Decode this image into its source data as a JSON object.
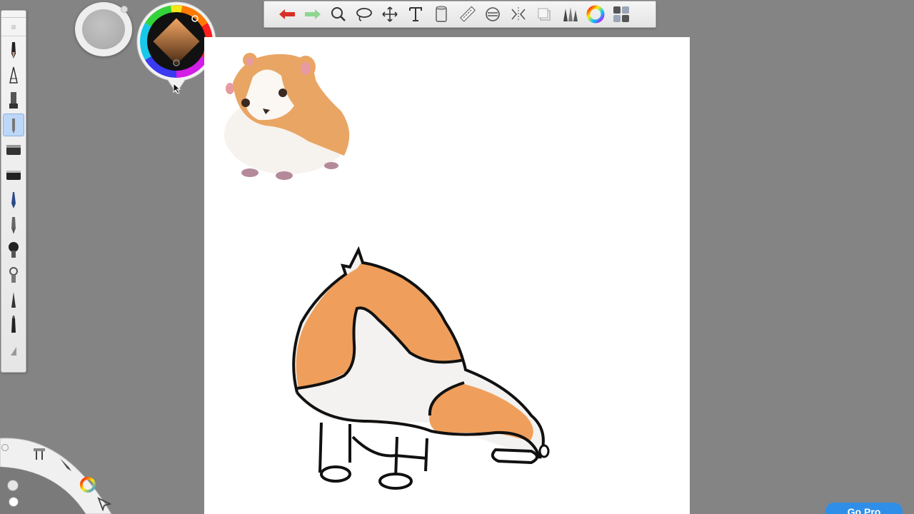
{
  "app": {
    "upgrade_button_label": "Go Pro"
  },
  "colors": {
    "background": "#848484",
    "undo_arrow": "#d93025",
    "redo_arrow": "#8fd68f",
    "hamster_orange": "#f0a661",
    "upgrade_blue": "#2f8fe8"
  },
  "toolbar": {
    "items": [
      "undo-icon",
      "redo-icon",
      "zoom-icon",
      "lasso-icon",
      "move-icon",
      "text-icon",
      "fill-icon",
      "ruler-icon",
      "symmetry-icon",
      "perspective-icon",
      "copy-icon",
      "brush-library-icon",
      "color-icon",
      "layers-icon"
    ]
  },
  "tool_palette": {
    "tools": [
      "pencil",
      "ballpoint-pen",
      "marker",
      "airbrush",
      "eraser",
      "hard-eraser",
      "paint-brush",
      "fine-pen",
      "soft-brush",
      "smear",
      "technical-pen",
      "felt-pen",
      "chisel"
    ],
    "active_tool": "airbrush"
  },
  "canvas": {
    "reference_image": "hamster-reference",
    "drawing": "hamster-drawing"
  }
}
